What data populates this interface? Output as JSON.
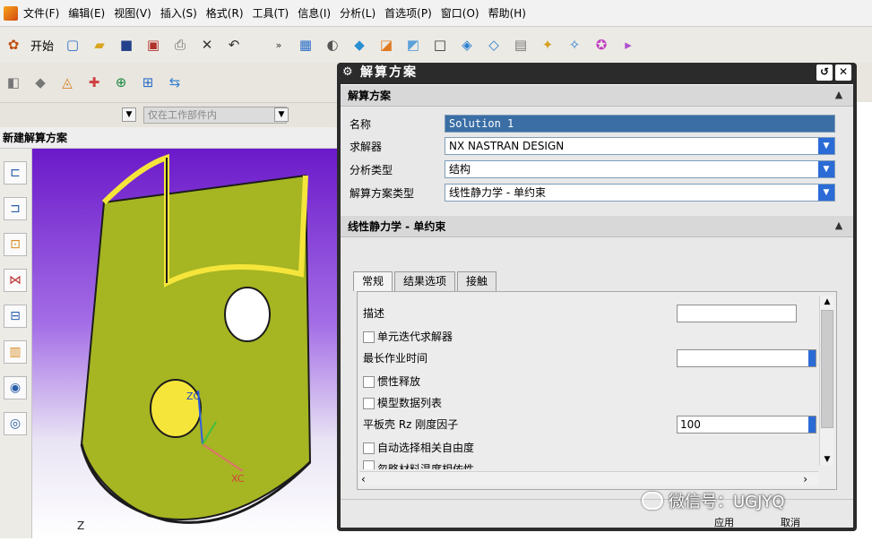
{
  "menu": {
    "items": [
      "文件(F)",
      "编辑(E)",
      "视图(V)",
      "插入(S)",
      "格式(R)",
      "工具(T)",
      "信息(I)",
      "分析(L)",
      "首选项(P)",
      "窗口(O)",
      "帮助(H)"
    ]
  },
  "toolbar": {
    "start_label": "开始"
  },
  "filter": {
    "text": "仅在工作部件内"
  },
  "left_panel": {
    "title": "新建解算方案"
  },
  "viewport": {
    "zc_label": "ZC",
    "xc_label": "XC",
    "z_label": "Z"
  },
  "dialog": {
    "title": "解算方案",
    "section1": {
      "header": "解算方案",
      "name_label": "名称",
      "name_value": "Solution 1",
      "solver_label": "求解器",
      "solver_value": "NX NASTRAN DESIGN",
      "analysis_type_label": "分析类型",
      "analysis_type_value": "结构",
      "solution_type_label": "解算方案类型",
      "solution_type_value": "线性静力学 - 单约束"
    },
    "section2": {
      "header": "线性静力学 - 单约束",
      "tabs": [
        "常规",
        "结果选项",
        "接触"
      ]
    },
    "panel": {
      "description_label": "描述",
      "element_iterative_label": "单元迭代求解器",
      "max_job_time_label": "最长作业时间",
      "inertia_relief_label": "惯性释放",
      "model_data_list_label": "模型数据列表",
      "plate_rz_label": "平板壳 Rz 刚度因子",
      "plate_rz_value": "100",
      "auto_dof_label": "自动选择相关自由度",
      "ignore_material_label": "忽略材料温度相依性"
    },
    "footer": {
      "apply_label": "应用",
      "cancel_label": "取消"
    }
  },
  "watermark": {
    "text": "微信号：UGJYQ"
  },
  "colors": {
    "viewport_top": "#6b19c9",
    "part_green": "#a6b522",
    "part_highlight": "#f5e53a",
    "dialog_dark": "#2b2b2b",
    "dropdown_blue": "#2b6bd6"
  }
}
